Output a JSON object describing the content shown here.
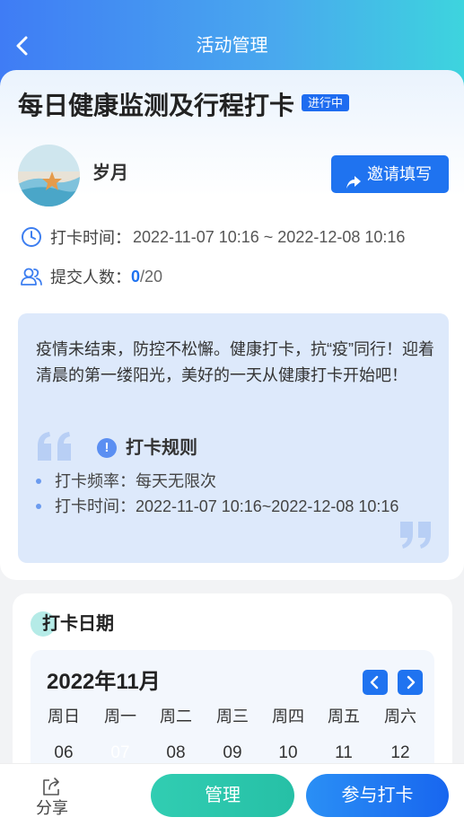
{
  "header": {
    "title": "活动管理",
    "back_icon": "chevron-left-icon"
  },
  "activity": {
    "title": "每日健康监测及行程打卡",
    "status": "进行中",
    "user_name": "岁月",
    "invite_label": "邀请填写",
    "time_label": "打卡时间：",
    "time_value": "2022-11-07 10:16 ~ 2022-12-08 10:16",
    "submit_label": "提交人数：",
    "submit_count": "0",
    "submit_total": "/20",
    "description": "疫情未结束，防控不松懈。健康打卡，抗“疫”同行！迎着清晨的第一缕阳光，美好的一天从健康打卡开始吧！",
    "rules_title": "打卡规则",
    "rules": [
      "打卡频率：每天无限次",
      "打卡时间：2022-11-07 10:16~2022-12-08 10:16"
    ]
  },
  "calendar": {
    "section_title": "打卡日期",
    "month": "2022年11月",
    "weekdays": [
      "周日",
      "周一",
      "周二",
      "周三",
      "周四",
      "周五",
      "周六"
    ],
    "days": [
      "06",
      "07",
      "08",
      "09",
      "10",
      "11",
      "12"
    ],
    "selected_day": "07"
  },
  "bottom": {
    "share_label": "分享",
    "manage_label": "管理",
    "join_label": "参与打卡"
  },
  "colors": {
    "primary": "#1f73f0",
    "teal": "#2ac4a9",
    "status": "#1e6cf0"
  }
}
